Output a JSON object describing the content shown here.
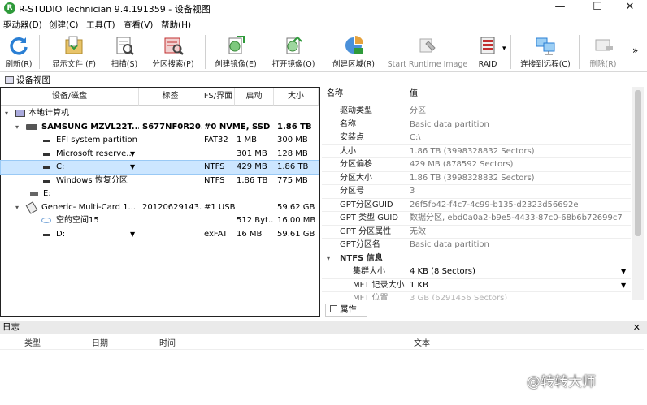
{
  "window": {
    "title": "R-STUDIO Technician 9.4.191359 - 设备视图",
    "app_icon": "R",
    "controls": [
      "—",
      "☐",
      "✕"
    ]
  },
  "menu": [
    "驱动器(D)",
    "创建(C)",
    "工具(T)",
    "查看(V)",
    "帮助(H)"
  ],
  "toolbar": {
    "refresh": "刷新(R)",
    "show_files": "显示文件 (F)",
    "scan": "扫描(S)",
    "partition_search": "分区搜索(P)",
    "create_image": "创建镜像(E)",
    "open_image": "打开镜像(O)",
    "create_region": "创建区域(R)",
    "start_runtime_image": "Start Runtime Image",
    "raid": "RAID",
    "connect_remote": "连接到远程(C)",
    "delete": "删除(R)",
    "more": "»"
  },
  "tabs": {
    "device_view": "设备视图",
    "properties": "属性"
  },
  "device_table": {
    "headers": [
      "设备/磁盘",
      "标签",
      "FS/界面",
      "启动",
      "大小"
    ],
    "rows": [
      {
        "name": "本地计算机",
        "label": "",
        "fs": "",
        "start": "",
        "size": ""
      },
      {
        "name": "SAMSUNG MZVL22T...",
        "label": "S677NF0R20...",
        "fs": "#0 NVME, SSD",
        "start": "",
        "size": "1.86 TB"
      },
      {
        "name": "EFI system partition",
        "label": "",
        "fs": "FAT32",
        "start": "1 MB",
        "size": "300 MB"
      },
      {
        "name": "Microsoft reserve...",
        "label": "",
        "fs": "",
        "start": "301 MB",
        "size": "128 MB"
      },
      {
        "name": "C:",
        "label": "",
        "fs": "NTFS",
        "start": "429 MB",
        "size": "1.86 TB"
      },
      {
        "name": "Windows 恢复分区",
        "label": "",
        "fs": "NTFS",
        "start": "1.86 TB",
        "size": "775 MB"
      },
      {
        "name": "E:",
        "label": "",
        "fs": "",
        "start": "",
        "size": ""
      },
      {
        "name": "Generic- Multi-Card 1...",
        "label": "20120629143...",
        "fs": "#1 USB",
        "start": "",
        "size": "59.62 GB"
      },
      {
        "name": "空的空间15",
        "label": "",
        "fs": "",
        "start": "512 Byt...",
        "size": "16.00 MB"
      },
      {
        "name": "D:",
        "label": "",
        "fs": "exFAT",
        "start": "16 MB",
        "size": "59.61 GB"
      }
    ]
  },
  "properties": {
    "headers": [
      "名称",
      "值"
    ],
    "rows": [
      {
        "key": "驱动类型",
        "value": "分区"
      },
      {
        "key": "名称",
        "value": "Basic data partition"
      },
      {
        "key": "安装点",
        "value": "C:\\"
      },
      {
        "key": "大小",
        "value": "1.86 TB (3998328832 Sectors)"
      },
      {
        "key": "分区偏移",
        "value": "429 MB (878592 Sectors)"
      },
      {
        "key": "分区大小",
        "value": "1.86 TB (3998328832 Sectors)"
      },
      {
        "key": "分区号",
        "value": "3"
      },
      {
        "key": "GPT分区GUID",
        "value": "26f5fb42-f4c7-4c99-b135-d2323d56692e"
      },
      {
        "key": "GPT 类型 GUID",
        "value": "数据分区, ebd0a0a2-b9e5-4433-87c0-68b6b72699c7"
      },
      {
        "key": "GPT 分区属性",
        "value": "无效"
      },
      {
        "key": "GPT分区名",
        "value": "Basic data partition"
      }
    ],
    "ntfs_section": "NTFS 信息",
    "ntfs_rows": [
      {
        "key": "集群大小",
        "value": "4 KB (8 Sectors)"
      },
      {
        "key": "MFT 记录大小",
        "value": "1 KB"
      },
      {
        "key": "MFT 位置",
        "value": "3 GB (6291456 Sectors)"
      }
    ]
  },
  "log": {
    "title": "日志",
    "close": "✕",
    "headers": [
      "类型",
      "日期",
      "时间",
      "文本"
    ]
  },
  "watermark": "@转转大师",
  "colors": {
    "selection": "#cce6ff",
    "accent": "#0078d7"
  }
}
